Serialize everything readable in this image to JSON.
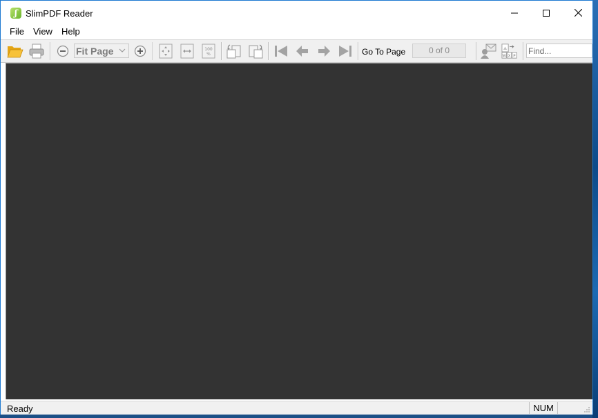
{
  "window": {
    "title": "SlimPDF Reader"
  },
  "menu": {
    "items": [
      "File",
      "View",
      "Help"
    ]
  },
  "toolbar": {
    "zoom_value": "Fit Page",
    "go_to_page_label": "Go To Page",
    "page_indicator": "0 of 0",
    "find_placeholder": "Find...",
    "icons": [
      "folder-open-icon",
      "printer-icon",
      "zoom-out-icon",
      "zoom-in-icon",
      "fit-page-icon",
      "fit-width-icon",
      "actual-size-icon",
      "rotate-ccw-icon",
      "rotate-cw-icon",
      "first-page-icon",
      "previous-page-icon",
      "next-page-icon",
      "last-page-icon",
      "share-icon",
      "convert-icon"
    ]
  },
  "status": {
    "text": "Ready",
    "num_indicator": "NUM"
  },
  "colors": {
    "viewer_background": "#333333",
    "window_border": "#1b78d0",
    "toolbar_background": "#f0f0f0"
  }
}
